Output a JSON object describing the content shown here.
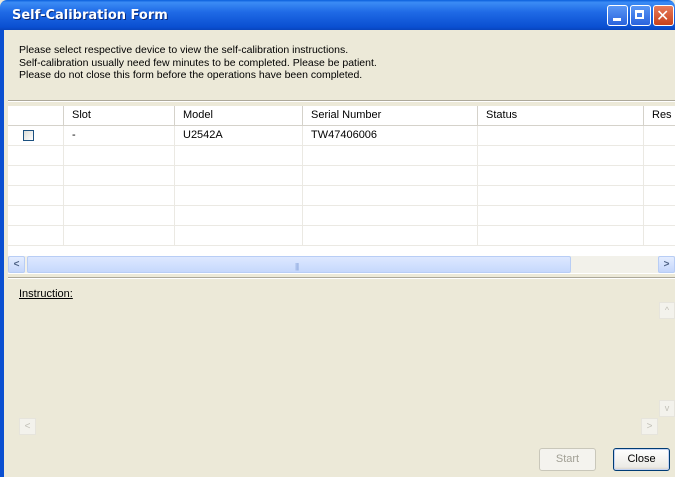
{
  "window": {
    "title": "Self-Calibration Form",
    "controls": {
      "minimize": "minimize-icon",
      "maximize": "maximize-icon",
      "close": "close-icon"
    }
  },
  "info": {
    "line1": "Please select respective device to view the self-calibration instructions.",
    "line2": "Self-calibration usually need few minutes to be completed. Please be patient.",
    "line3": "Please do not close this form before the operations have been completed."
  },
  "table": {
    "headers": [
      "Slot",
      "Model",
      "Serial Number",
      "Status",
      "Res"
    ],
    "rows": [
      {
        "checked": false,
        "slot": "-",
        "model": "U2542A",
        "serial": "TW47406006",
        "status": "",
        "result": ""
      }
    ]
  },
  "instruction": {
    "label": "Instruction:"
  },
  "buttons": {
    "start": "Start",
    "close": "Close"
  },
  "colors": {
    "titlebar": "#0a4fd1",
    "background": "#ece9d8"
  }
}
